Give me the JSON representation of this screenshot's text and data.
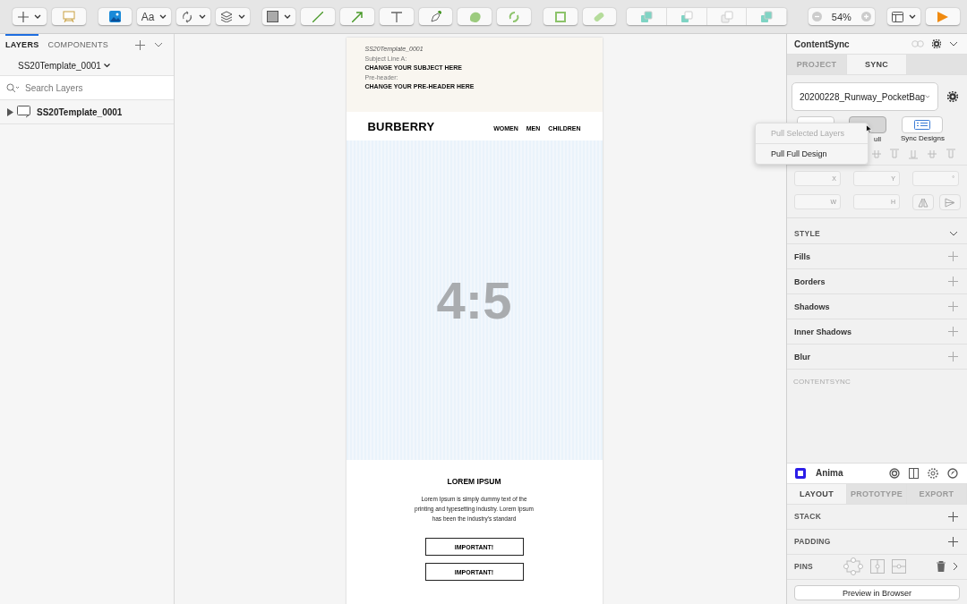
{
  "toolbar": {
    "text_style_label": "Aa",
    "zoom": "54%"
  },
  "layers_panel": {
    "tabs": [
      {
        "label": "LAYERS",
        "selected": true
      },
      {
        "label": "COMPONENTS",
        "selected": false
      }
    ],
    "page": "SS20Template_0001",
    "search": {
      "placeholder": "Search Layers"
    },
    "layers": [
      {
        "name": "SS20Template_0001",
        "expanded": false
      }
    ]
  },
  "artboard": {
    "meta_title": "SS20Template_0001",
    "subject_label": "Subject Line A:",
    "subject": "CHANGE YOUR SUBJECT HERE",
    "preheader_label": "Pre-header:",
    "preheader": "CHANGE YOUR PRE-HEADER HERE",
    "logo": "BURBERRY",
    "nav": [
      "WOMEN",
      "MEN",
      "CHILDREN"
    ],
    "image_ratio": "4:5",
    "heading": "LOREM IPSUM",
    "body": "Lorem Ipsum is simply dummy text of the printing and typesetting industry. Lorem Ipsum has been the industry's standard",
    "buttons": [
      "IMPORTANT!",
      "IMPORTANT!"
    ]
  },
  "contentsync": {
    "title": "ContentSync",
    "tabs": [
      {
        "label": "PROJECT",
        "selected": false
      },
      {
        "label": "SYNC",
        "selected": true
      }
    ],
    "project": "20200228_Runway_PocketBag",
    "pull_label": "ull",
    "sync_label": "Sync Designs",
    "menu": [
      {
        "label": "Pull Selected Layers",
        "disabled": true
      },
      {
        "label": "Pull Full Design",
        "disabled": false
      }
    ],
    "fields": [
      [
        "X",
        "Y",
        "°"
      ],
      [
        "W",
        "H"
      ]
    ],
    "style_heading": "STYLE",
    "style_rows": [
      "Fills",
      "Borders",
      "Shadows",
      "Inner Shadows",
      "Blur"
    ],
    "footer": "CONTENTSYNC"
  },
  "anima": {
    "title": "Anima",
    "tabs": [
      {
        "label": "LAYOUT",
        "selected": true
      },
      {
        "label": "PROTOTYPE",
        "selected": false
      },
      {
        "label": "EXPORT",
        "selected": false
      }
    ],
    "rows": [
      {
        "label": "STACK",
        "kind": "add"
      },
      {
        "label": "PADDING",
        "kind": "add"
      },
      {
        "label": "PINS",
        "kind": "pins"
      }
    ],
    "preview": "Preview in Browser"
  }
}
